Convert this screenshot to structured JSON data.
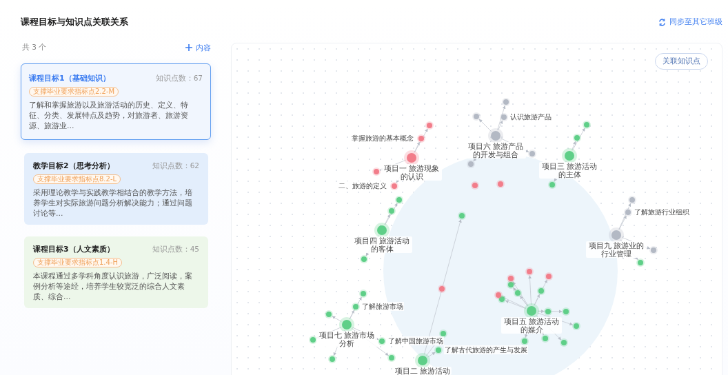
{
  "header": {
    "title": "课程目标与知识点关联关系",
    "sync_link": "同步至其它班级"
  },
  "goals_panel": {
    "count": "共 3 个",
    "add_button": "内容",
    "goals": [
      {
        "title": "课程目标1（基础知识）",
        "count": "知识点数：67",
        "tag": "支撑毕业要求指标点2.2-M",
        "description": "了解和掌握旅游以及旅游活动的历史、定义、特征、分类、发展特点及趋势，对旅游者、旅游资源、旅游业…",
        "color": "#f1f6fe",
        "selected": true
      },
      {
        "title": "教学目标2（思考分析）",
        "count": "知识点数：62",
        "tag": "支撑毕业要求指标点8.2-L",
        "description": "采用理论教学与实践教学相结合的教学方法，培养学生对实际旅游问题分析解决能力；通过问题讨论等…",
        "color": "#e3eefc",
        "selected": false
      },
      {
        "title": "课程目标3（人文素质）",
        "count": "知识点数：45",
        "tag": "支撑毕业要求指标点1.4-H",
        "description": "本课程通过多学科角度认识旅游，广泛阅读，案例分析等途经，培养学生较宽泛的综合人文素质、综合…",
        "color": "#edf7ea",
        "selected": false
      }
    ]
  },
  "graph": {
    "button": "关联知识点",
    "hubs": [
      {
        "label": "项目一 旅游现象的认识",
        "color": "#f27d8a",
        "children": [
          {
            "label": "掌握旅游的基本概念",
            "color": "#f27d8a"
          },
          {
            "color": "#f27d8a"
          },
          {
            "color": "#f27d8a"
          },
          {
            "label": "二、旅游的定义",
            "color": "#f27d8a"
          }
        ]
      },
      {
        "label": "项目六 旅游产品的开发与组合",
        "color": "#b3b9c4",
        "children": [
          {
            "label": "认识旅游产品",
            "color": "#b3b9c4"
          },
          {
            "color": "#b3b9c4"
          },
          {
            "color": "#b3b9c4"
          },
          {
            "color": "#b3b9c4"
          },
          {
            "color": "#b3b9c4"
          }
        ]
      },
      {
        "label": "项目三 旅游活动的主体",
        "color": "#5fcf88",
        "children": [
          {
            "color": "#5fcf88"
          },
          {
            "color": "#5fcf88"
          },
          {
            "color": "#5fcf88"
          }
        ]
      },
      {
        "label": "项目四 旅游活动的客体",
        "color": "#5fcf88",
        "children": [
          {
            "color": "#5fcf88"
          },
          {
            "color": "#5fcf88"
          },
          {
            "color": "#5fcf88"
          }
        ]
      },
      {
        "label": "项目九 旅游业的行业管理",
        "color": "#b3b9c4",
        "children": [
          {
            "label": "了解旅游行业组织",
            "color": "#b3b9c4"
          },
          {
            "color": "#b3b9c4"
          },
          {
            "color": "#b3b9c4"
          },
          {
            "color": "#5fcf88"
          }
        ]
      },
      {
        "label": "项目七 旅游市场分析",
        "color": "#5fcf88",
        "children": [
          {
            "label": "了解旅游市场",
            "color": "#5fcf88"
          },
          {
            "label": "了解中国旅游市场",
            "color": "#5fcf88"
          },
          {
            "color": "#5fcf88"
          },
          {
            "color": "#5fcf88"
          },
          {
            "color": "#5fcf88"
          },
          {
            "color": "#5fcf88"
          },
          {
            "color": "#5fcf88"
          }
        ]
      },
      {
        "label": "项目五 旅游活动的媒介",
        "color": "#5fcf88",
        "children": [
          {
            "color": "#5fcf88"
          },
          {
            "color": "#5fcf88"
          },
          {
            "color": "#5fcf88"
          },
          {
            "color": "#5fcf88"
          },
          {
            "color": "#5fcf88"
          },
          {
            "color": "#5fcf88"
          },
          {
            "color": "#5fcf88"
          },
          {
            "color": "#5fcf88"
          },
          {
            "color": "#5fcf88"
          },
          {
            "color": "#5fcf88"
          },
          {
            "color": "#f27d8a"
          },
          {
            "color": "#f27d8a"
          },
          {
            "color": "#f27d8a"
          },
          {
            "color": "#f27d8a"
          }
        ]
      },
      {
        "label": "项目二 旅游活动",
        "color": "#5fcf88",
        "children": [
          {
            "label": "了解古代旅游的产生与发展",
            "color": "#5fcf88"
          },
          {
            "color": "#5fcf88"
          },
          {
            "color": "#5fcf88"
          }
        ]
      }
    ],
    "loose_nodes": [
      {
        "color": "#f27d8a"
      },
      {
        "color": "#f27d8a"
      },
      {
        "color": "#f27d8a"
      }
    ]
  }
}
